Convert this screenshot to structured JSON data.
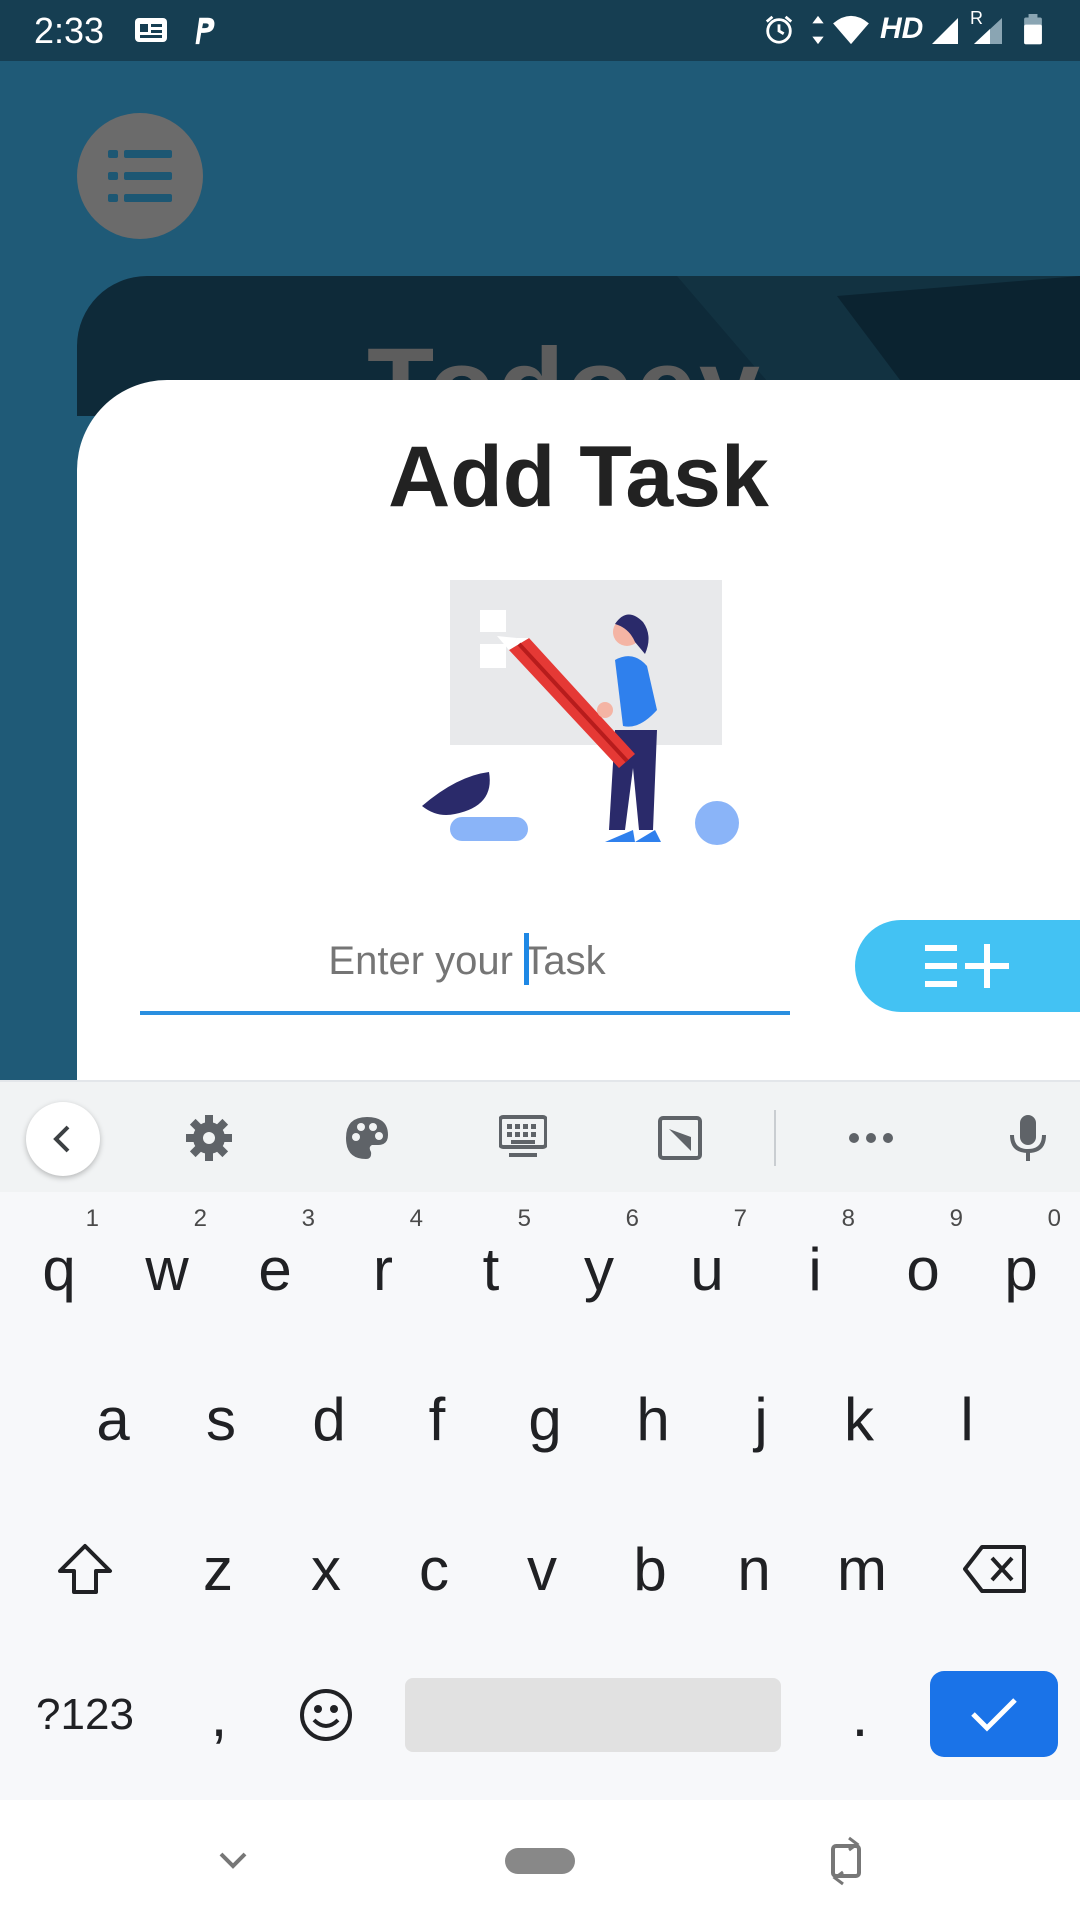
{
  "status_bar": {
    "time": "2:33",
    "network_label": "HD",
    "roaming_label": "R",
    "battery_level": "7"
  },
  "app": {
    "header_title": "Todoey",
    "sheet": {
      "title": "Add Task",
      "input_placeholder": "Enter your Task",
      "input_value": ""
    }
  },
  "keyboard": {
    "row1": [
      {
        "label": "q",
        "hint": "1"
      },
      {
        "label": "w",
        "hint": "2"
      },
      {
        "label": "e",
        "hint": "3"
      },
      {
        "label": "r",
        "hint": "4"
      },
      {
        "label": "t",
        "hint": "5"
      },
      {
        "label": "y",
        "hint": "6"
      },
      {
        "label": "u",
        "hint": "7"
      },
      {
        "label": "i",
        "hint": "8"
      },
      {
        "label": "o",
        "hint": "9"
      },
      {
        "label": "p",
        "hint": "0"
      }
    ],
    "row2": [
      "a",
      "s",
      "d",
      "f",
      "g",
      "h",
      "j",
      "k",
      "l"
    ],
    "row3": [
      "z",
      "x",
      "c",
      "v",
      "b",
      "n",
      "m"
    ],
    "symbols_label": "?123",
    "comma_label": ",",
    "period_label": "."
  },
  "colors": {
    "accent": "#1a73e8",
    "add_button": "#43c2f3",
    "app_background": "#1f5a77"
  }
}
